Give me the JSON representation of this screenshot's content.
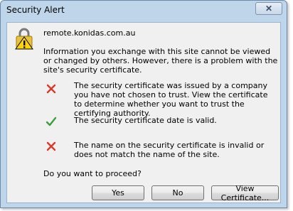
{
  "window": {
    "title": "Security Alert"
  },
  "dialog": {
    "site": "remote.konidas.com.au",
    "info": "Information you exchange with this site cannot be viewed or changed by others. However, there is a problem with the site's security certificate.",
    "items": [
      {
        "status": "error",
        "icon": "red-x-icon",
        "text": "The security certificate was issued by a company you have not chosen to trust. View the certificate to determine whether you want to trust the certifying authority."
      },
      {
        "status": "ok",
        "icon": "green-check-icon",
        "text": "The security certificate date is valid."
      },
      {
        "status": "error",
        "icon": "red-x-icon",
        "text": "The name on the security certificate is invalid or does not match the name of the site."
      }
    ],
    "question": "Do you want to proceed?"
  },
  "buttons": {
    "yes": "Yes",
    "no": "No",
    "view": "View Certificate..."
  },
  "colors": {
    "error": "#d83a2a",
    "ok": "#3aa03a",
    "accent": "#bfd5ea"
  }
}
